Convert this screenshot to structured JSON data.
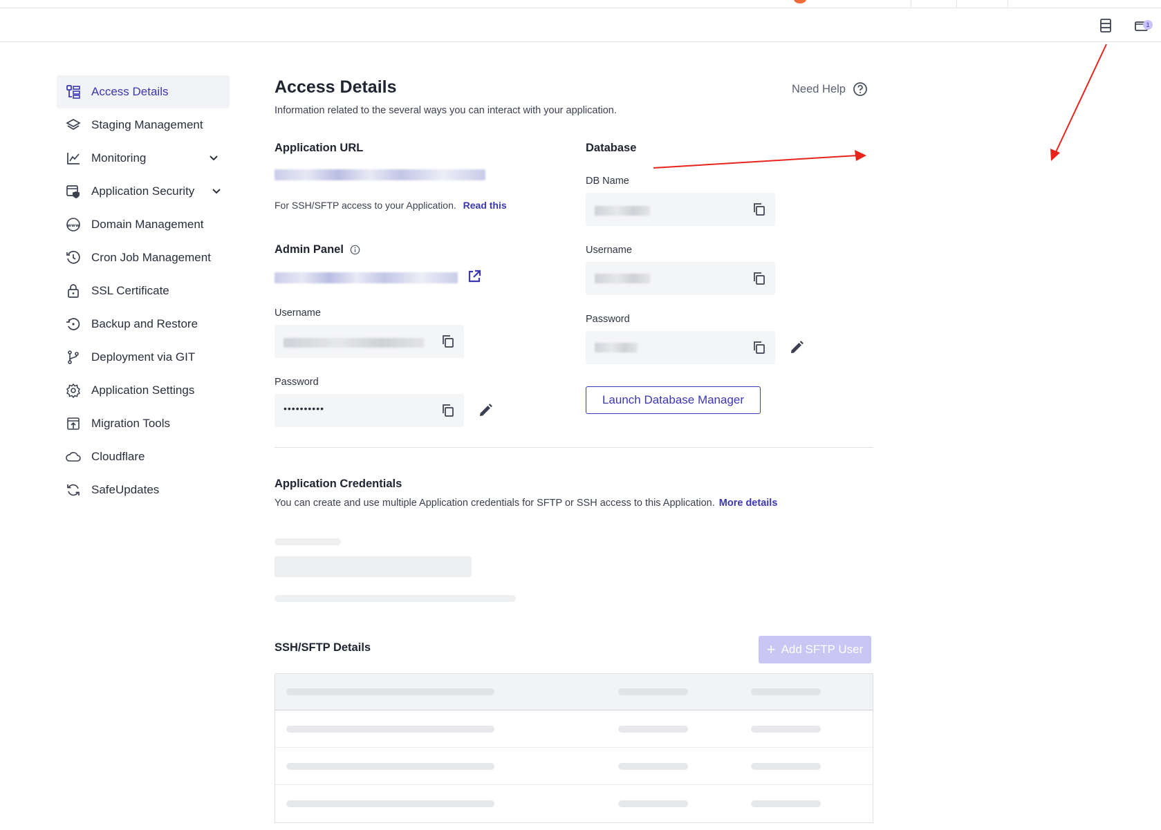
{
  "sidebar": {
    "items": [
      {
        "label": "Access Details",
        "icon": "list-details-icon",
        "active": true
      },
      {
        "label": "Staging Management",
        "icon": "layers-icon"
      },
      {
        "label": "Monitoring",
        "icon": "chart-line-icon",
        "expandable": true
      },
      {
        "label": "Application Security",
        "icon": "shield-window-icon",
        "expandable": true
      },
      {
        "label": "Domain Management",
        "icon": "www-globe-icon"
      },
      {
        "label": "Cron Job Management",
        "icon": "history-clock-icon"
      },
      {
        "label": "SSL Certificate",
        "icon": "lock-icon"
      },
      {
        "label": "Backup and Restore",
        "icon": "backup-restore-icon"
      },
      {
        "label": "Deployment via GIT",
        "icon": "git-branch-icon"
      },
      {
        "label": "Application Settings",
        "icon": "gear-icon"
      },
      {
        "label": "Migration Tools",
        "icon": "migration-upload-icon"
      },
      {
        "label": "Cloudflare",
        "icon": "cloud-icon"
      },
      {
        "label": "SafeUpdates",
        "icon": "refresh-icon"
      }
    ]
  },
  "header": {
    "title": "Access Details",
    "subtitle": "Information related to the several ways you can interact with your application.",
    "help_label": "Need Help",
    "notification_count": "1"
  },
  "app_url": {
    "title": "Application URL",
    "ssh_note": "For SSH/SFTP access to your Application.",
    "read_this": "Read this"
  },
  "admin_panel": {
    "title": "Admin Panel",
    "username_label": "Username",
    "password_label": "Password",
    "password_value": "••••••••••"
  },
  "database": {
    "title": "Database",
    "db_name_label": "DB Name",
    "username_label": "Username",
    "password_label": "Password",
    "launch_button": "Launch Database Manager"
  },
  "credentials": {
    "title": "Application Credentials",
    "description": "You can create and use multiple Application credentials for SFTP or SSH access to this Application.",
    "more_details": "More details"
  },
  "ssh_sftp": {
    "title": "SSH/SFTP Details",
    "add_button": "Add SFTP User"
  },
  "colors": {
    "accent": "#3a37b5",
    "annotation_arrow": "#e8231a"
  }
}
